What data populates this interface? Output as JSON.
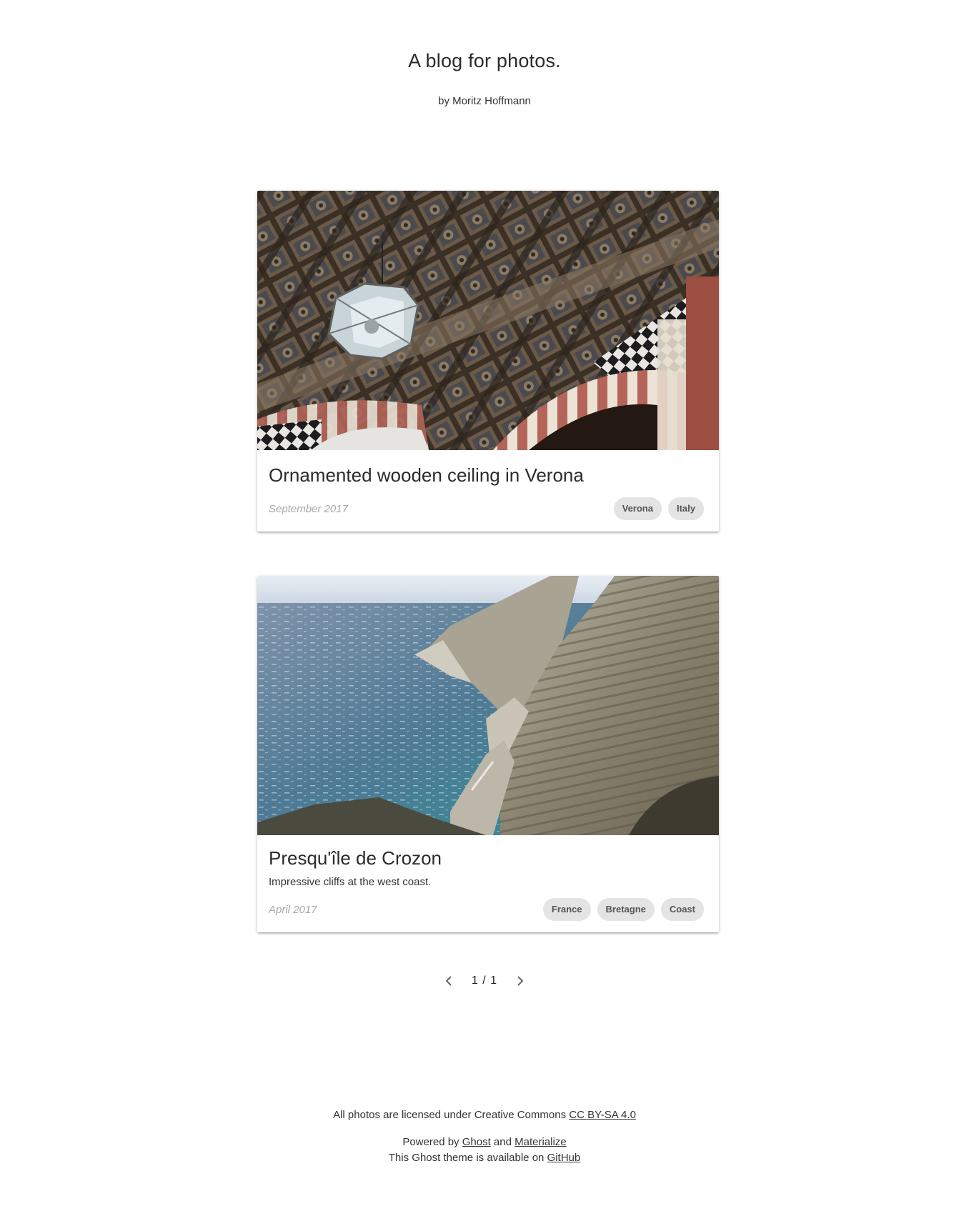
{
  "site": {
    "title": "A blog for photos.",
    "author": "by Moritz Hoffmann"
  },
  "posts": [
    {
      "title": "Ornamented wooden ceiling in Verona",
      "excerpt": "",
      "date": "September 2017",
      "tags": [
        "Verona",
        "Italy"
      ],
      "image": "ornamented-ceiling-photo"
    },
    {
      "title": "Presqu'île de Crozon",
      "excerpt": "Impressive cliffs at the west coast.",
      "date": "April 2017",
      "tags": [
        "France",
        "Bretagne",
        "Coast"
      ],
      "image": "sea-cliffs-photo"
    }
  ],
  "pagination": {
    "label": "1 / 1",
    "prev_icon": "chevron-left-icon",
    "next_icon": "chevron-right-icon"
  },
  "footer": {
    "license_text": "All photos are licensed under Creative Commons ",
    "license_link": "CC BY-SA 4.0",
    "powered_prefix": "Powered by ",
    "ghost_link": "Ghost",
    "and_text": " and ",
    "materialize_link": "Materialize",
    "theme_prefix": "This Ghost theme is available on ",
    "github_link": "GitHub"
  },
  "colors": {
    "chip_bg": "#e4e4e4",
    "date": "#a8a8a8",
    "text": "#333333"
  }
}
